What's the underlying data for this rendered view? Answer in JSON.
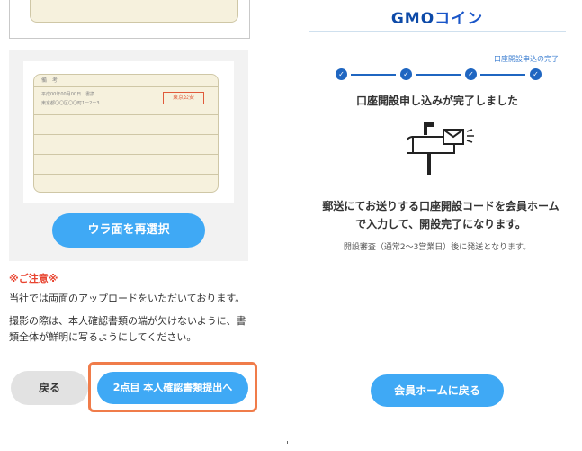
{
  "left": {
    "license": {
      "header": "備　考",
      "line1": "平成00年00月00日　書換",
      "line2": "東京都〇〇区〇〇町1ー2ー3",
      "stamp": "東京公安"
    },
    "reselect_label": "ウラ面を再選択",
    "notice_title": "※ご注意※",
    "notice_p1": "当社では両面のアップロードをいただいております。",
    "notice_p2": "撮影の際は、本人確認書類の端が欠けないように、書類全体が鮮明に写るようにしてください。",
    "back_label": "戻る",
    "submit_label": "2点目 本人確認書類提出へ"
  },
  "right": {
    "logo_a": "GMO",
    "logo_b": "コイン",
    "step_label": "口座開設申込の完了",
    "done_title": "口座開設申し込みが完了しました",
    "mail_text": "郵送にてお送りする口座開設コードを会員ホームで入力して、開設完了になります。",
    "mail_sub": "開設審査（通常2〜3営業日）後に発送となります。",
    "home_label": "会員ホームに戻る"
  },
  "colors": {
    "accent_blue": "#3fa9f5",
    "brand_blue": "#0d4aa8",
    "warning_red": "#e8432f",
    "highlight_orange": "#f07c4a"
  },
  "icons": [
    "check-icon",
    "mailbox-icon"
  ]
}
